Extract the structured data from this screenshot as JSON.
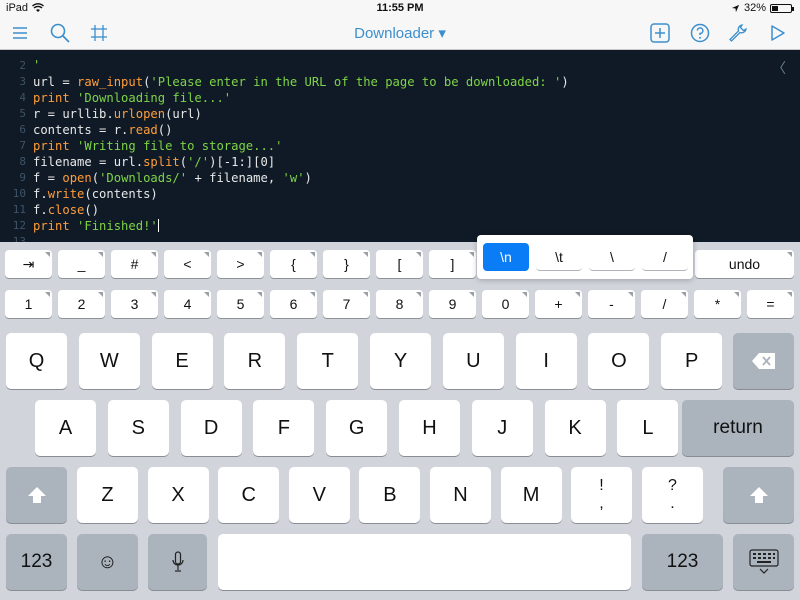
{
  "status": {
    "device": "iPad",
    "time": "11:55 PM",
    "battery": "32%",
    "battery_level": 0.32
  },
  "toolbar": {
    "title": "Downloader ▾",
    "menu_icon": "hamburger-icon",
    "search_icon": "search-icon",
    "grid_icon": "grid-icon",
    "add_icon": "plus-square-icon",
    "help_icon": "help-icon",
    "settings_icon": "wrench-icon",
    "run_icon": "play-icon"
  },
  "editor": {
    "top_partial": "'",
    "lines": [
      {
        "n": "2",
        "text": ""
      },
      {
        "n": "3",
        "a": "url = ",
        "b": "raw_input",
        "c": "(",
        "d": "'Please enter in the URL of the page to be downloaded: '",
        "e": ")"
      },
      {
        "n": "4",
        "a": "",
        "b": "print",
        "c": " ",
        "d": "'Downloading file...'",
        "e": ""
      },
      {
        "n": "5",
        "a": "r = urllib.",
        "b": "urlopen",
        "c": "(url)",
        "d": "",
        "e": ""
      },
      {
        "n": "6",
        "a": "contents = r.",
        "b": "read",
        "c": "()",
        "d": "",
        "e": ""
      },
      {
        "n": "7",
        "a": "",
        "b": "print",
        "c": " ",
        "d": "'Writing file to storage...'",
        "e": ""
      },
      {
        "n": "8",
        "a": "filename = url.",
        "b": "split",
        "c": "(",
        "d": "'/'",
        "e": ")[-1:][0]"
      },
      {
        "n": "9",
        "a": "f = ",
        "b": "open",
        "c": "(",
        "d": "'Downloads/'",
        "e": " + filename, ",
        "f": "'w'",
        "g": ")"
      },
      {
        "n": "10",
        "a": "f.",
        "b": "write",
        "c": "(contents)",
        "d": "",
        "e": ""
      },
      {
        "n": "11",
        "a": "f.",
        "b": "close",
        "c": "()",
        "d": "",
        "e": ""
      },
      {
        "n": "12",
        "a": "",
        "b": "print",
        "c": " ",
        "d": "'Finished!'",
        "e": ""
      },
      {
        "n": "13",
        "text": ""
      }
    ],
    "collapse_glyph": "〈"
  },
  "extra_row1": [
    "⇥",
    "_",
    "#",
    "<",
    ">",
    "{",
    "}",
    "[",
    "]"
  ],
  "extra_row1_right": "undo",
  "popup": [
    "\\n",
    "\\t",
    "\\",
    "/"
  ],
  "extra_row2": [
    "1",
    "2",
    "3",
    "4",
    "5",
    "6",
    "7",
    "8",
    "9",
    "0",
    "+",
    "-",
    "/",
    "*",
    "="
  ],
  "keys_row1": [
    "Q",
    "W",
    "E",
    "R",
    "T",
    "Y",
    "U",
    "I",
    "O",
    "P"
  ],
  "keys_row2": [
    "A",
    "S",
    "D",
    "F",
    "G",
    "H",
    "J",
    "K",
    "L"
  ],
  "keys_row3": [
    "Z",
    "X",
    "C",
    "V",
    "B",
    "N",
    "M"
  ],
  "keys_special": {
    "return": "return",
    "num_left": "123",
    "num_right": "123",
    "emoji": "☺",
    "punct1_top": "!",
    "punct1_bot": ",",
    "punct2_top": "?",
    "punct2_bot": "."
  }
}
